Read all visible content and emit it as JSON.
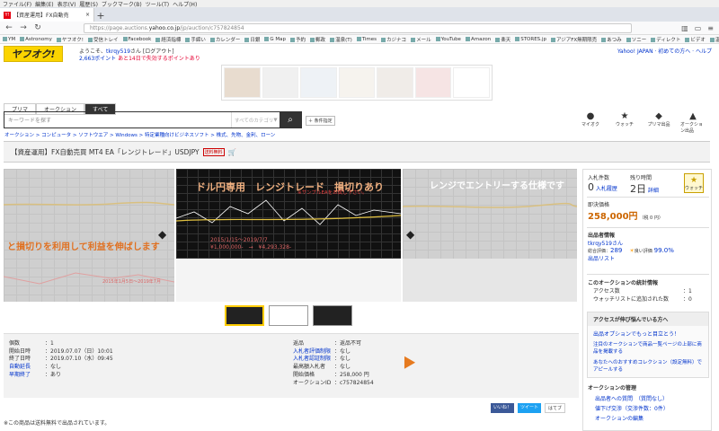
{
  "menubar": [
    "ファイル(F)",
    "編集(E)",
    "表示(V)",
    "履歴(S)",
    "ブックマーク(B)",
    "ツール(T)",
    "ヘルプ(H)"
  ],
  "tab": {
    "title": "【資産運用】FX自動売",
    "favicon": "Y!",
    "close": "×",
    "new_tab": "+"
  },
  "nav": {
    "back": "←",
    "forward": "→",
    "reload": "↻",
    "url_prefix": "https://page.auctions.",
    "url_domain": "yahoo.co.jp",
    "url_path": "/jp/auction/c757824854",
    "menu": "≡"
  },
  "bookmarks": [
    "YM",
    "Astronomy",
    "ヤフオク!",
    "受信トレイ",
    "Facebook",
    "経済指標",
    "手締い",
    "カレンダー",
    "日銀",
    "G Map",
    "予約",
    "郵政",
    "温泉(T)",
    "Times",
    "カジナコ",
    "メール",
    "YouTube",
    "Amazon",
    "楽天",
    "STORES.jp",
    "アジアFX無期限売",
    "あつみ",
    "ソニー",
    "ディレクト",
    "ビデオ",
    "温泉カード"
  ],
  "header": {
    "logo": "ヤフオク!",
    "welcome_prefix": "ようこそ、",
    "user": "tkrqy519",
    "welcome_suffix": "さん [ログアウト]",
    "points": "2,663ポイント",
    "points_note": "あと14日で失効するポイントあり",
    "right_links": "Yahoo! JAPAN · 初めての方へ · ヘルプ"
  },
  "search": {
    "tabs": [
      "プリマ",
      "オークション",
      "すべて"
    ],
    "placeholder": "キーワードを探す",
    "category": "すべてのカテゴリ",
    "button": "⌕",
    "advanced": "＋ 条件指定"
  },
  "top_icons": [
    {
      "glyph": "●",
      "label": "マイオク"
    },
    {
      "glyph": "★",
      "label": "ウォッチ"
    },
    {
      "glyph": "◆",
      "label": "プリマ出品"
    },
    {
      "glyph": "▲",
      "label": "オークション出品"
    }
  ],
  "breadcrumb": "オークション > コンピュータ > ソフトウエア > Windows > 特定業種向けビジネスソフト > 株式、先物、金利、ローン",
  "title": {
    "text": "【資産運用】FX自動売買 MT4 EA「レンジトレード」USDJPY",
    "badge": "送料無料"
  },
  "photos": {
    "p1_text": "と損切りを利用して利益を伸ばします",
    "p1_sub": "2015年1月5日〜2019年7月",
    "p2_title": "ドル円専用　レンジトレード　損切りあり",
    "p2_note": "※サンプルEAをお試し下さい。",
    "p2_dates": "2015/1/15〜2019/7/7",
    "p2_values": "¥1,000,000-　→　¥4,293,328-",
    "p3_text": "レンジでエントリーする仕様です"
  },
  "details_left": [
    {
      "k": "個数",
      "v": "：1",
      "link": false
    },
    {
      "k": "開始日時",
      "v": "：2019.07.07（日）10:01",
      "link": false
    },
    {
      "k": "終了日時",
      "v": "：2019.07.10（水）09:45",
      "link": false
    },
    {
      "k": "自動延長",
      "v": "：なし",
      "link": true
    },
    {
      "k": "早期終了",
      "v": "：あり",
      "link": true
    }
  ],
  "details_right": [
    {
      "k": "返品",
      "v": "：返品不可",
      "link": false
    },
    {
      "k": "入札者評価制限",
      "v": "：なし",
      "link": true
    },
    {
      "k": "入札者認証制限",
      "v": "：なし",
      "link": true
    },
    {
      "k": "最高額入札者",
      "v": "：なし",
      "link": false
    },
    {
      "k": "開始価格",
      "v": "：258,000 円",
      "link": false
    },
    {
      "k": "オークションID",
      "v": "：c757824854",
      "link": false
    }
  ],
  "social": [
    "いいね！",
    "ツイート",
    "はてブ"
  ],
  "footnote": "※この商品は送料無料で出品されています。",
  "side": {
    "bid_label": "入札件数",
    "bid_count": "0",
    "bid_unit": "入札履歴",
    "remain_label": "残り時間",
    "remain": "2日",
    "remain_link": "詳細",
    "watch": "ウォッチ",
    "price_label": "即決価格",
    "price": "258,000円",
    "price_tax": "（税 0 円）",
    "seller_label": "出品者情報",
    "seller": "tkrqy519さん",
    "rating_label": "総合評価：",
    "rating": "289",
    "good_label": "良い評価",
    "good": "99.0%",
    "seller_list": "出品リスト",
    "stats_title": "このオークションの統計情報",
    "access_label": "アクセス数",
    "access": "：1",
    "watchers_label": "ウォッチリストに追加された数",
    "watchers": "：0",
    "promo_title": "アクセスが伸び悩んでいる方へ",
    "promo_link": "出品オプションでもっと目立とう！",
    "promo_sub": "注目のオークションで商品一覧ページの上部に商品を掲載する",
    "promo_sub2": "あなたへのおすすめコレクション（設定無料）でアピールする",
    "manage_title": "オークションの管理",
    "manage_links": [
      "出品者への質問　（質問なし）",
      "値下げ交渉（交渉件数：0件）",
      "オークションの編集"
    ]
  }
}
